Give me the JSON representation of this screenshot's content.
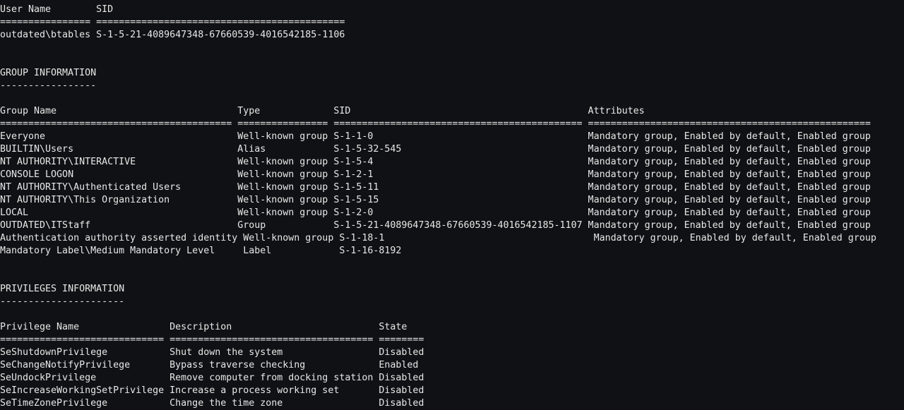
{
  "terminal": {
    "lines": [
      "User Name        SID",
      "================ ============================================",
      "outdated\\btables S-1-5-21-4089647348-67660539-4016542185-1106",
      "",
      "",
      "GROUP INFORMATION",
      "-----------------",
      "",
      "Group Name                                Type             SID                                          Attributes",
      "========================================= ================ ============================================ ==================================================",
      "Everyone                                  Well-known group S-1-1-0                                      Mandatory group, Enabled by default, Enabled group",
      "BUILTIN\\Users                             Alias            S-1-5-32-545                                 Mandatory group, Enabled by default, Enabled group",
      "NT AUTHORITY\\INTERACTIVE                  Well-known group S-1-5-4                                      Mandatory group, Enabled by default, Enabled group",
      "CONSOLE LOGON                             Well-known group S-1-2-1                                      Mandatory group, Enabled by default, Enabled group",
      "NT AUTHORITY\\Authenticated Users          Well-known group S-1-5-11                                     Mandatory group, Enabled by default, Enabled group",
      "NT AUTHORITY\\This Organization            Well-known group S-1-5-15                                     Mandatory group, Enabled by default, Enabled group",
      "LOCAL                                     Well-known group S-1-2-0                                      Mandatory group, Enabled by default, Enabled group",
      "OUTDATED\\ITStaff                          Group            S-1-5-21-4089647348-67660539-4016542185-1107 Mandatory group, Enabled by default, Enabled group",
      "Authentication authority asserted identity Well-known group S-1-18-1                                     Mandatory group, Enabled by default, Enabled group",
      "Mandatory Label\\Medium Mandatory Level     Label            S-1-16-8192",
      "",
      "",
      "PRIVILEGES INFORMATION",
      "----------------------",
      "",
      "Privilege Name                Description                          State",
      "============================= ==================================== ========",
      "SeShutdownPrivilege           Shut down the system                 Disabled",
      "SeChangeNotifyPrivilege       Bypass traverse checking             Enabled",
      "SeUndockPrivilege             Remove computer from docking station Disabled",
      "SeIncreaseWorkingSetPrivilege Increase a process working set       Disabled",
      "SeTimeZonePrivilege           Change the time zone                 Disabled"
    ]
  }
}
